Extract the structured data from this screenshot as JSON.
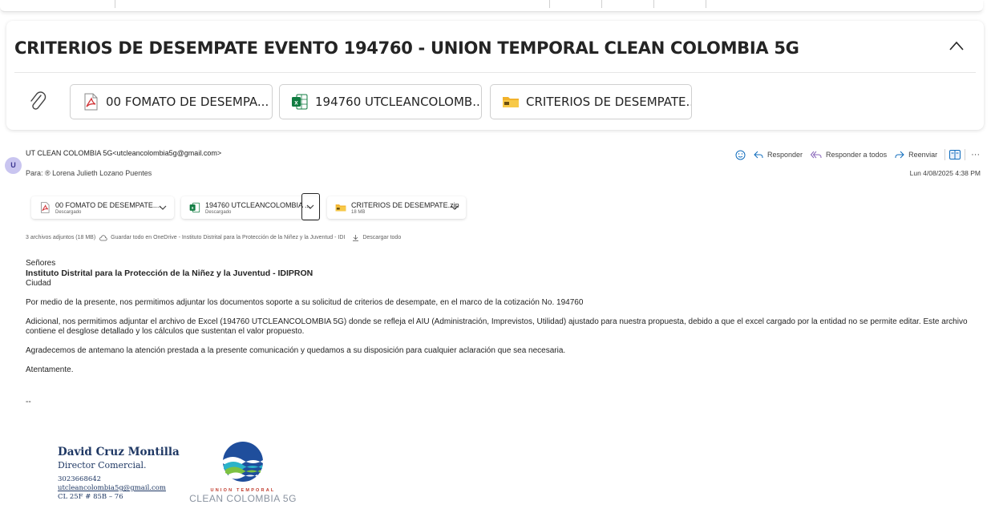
{
  "email": {
    "subject": "CRITERIOS DE DESEMPATE EVENTO 194760 - UNION TEMPORAL CLEAN COLOMBIA 5G",
    "top_attachments": [
      {
        "name": "00 FOMATO DE DESEMPA...",
        "icon": "pdf-icon"
      },
      {
        "name": "194760 UTCLEANCOLOMB...",
        "icon": "excel-icon"
      },
      {
        "name": "CRITERIOS DE DESEMPATE...",
        "icon": "zip-folder-icon"
      }
    ],
    "avatar_initial": "U",
    "sender": "UT CLEAN COLOMBIA 5G<utcleancolombia5g@gmail.com>",
    "to": "Para: ® Lorena Julieth Lozano Puentes",
    "date": "Lun 4/08/2025 4:38 PM",
    "actions": {
      "reply": "Responder",
      "reply_all": "Responder a todos",
      "forward": "Reenviar",
      "more": "···"
    },
    "attachments": [
      {
        "name": "00 FOMATO DE DESEMPATE....",
        "status": "Descargado"
      },
      {
        "name": "194760 UTCLEANCOLOMBIA ...",
        "status": "Descargado"
      },
      {
        "name": "CRITERIOS DE DESEMPATE.zip",
        "status": "18 MB"
      }
    ],
    "attachments_summary": {
      "count": "3 archivos adjuntos (18 MB)",
      "save_onedrive": "Guardar todo en OneDrive - Instituto Distrital para la Protección de la Niñez y la Juventud - IDI",
      "download_all": "Descargar todo"
    },
    "body": {
      "salutation": "Señores",
      "institution": "Instituto Distrital para la Protección de la Niñez y la Juventud - IDIPRON",
      "city": "Ciudad",
      "p1": "Por medio de la presente, nos permitimos adjuntar los documentos soporte a su solicitud de criterios de desempate, en el marco de la cotización No. 194760",
      "p2": "Adicional, nos permitimos adjuntar el archivo de Excel (194760 UTCLEANCOLOMBIA 5G) donde se refleja el AIU (Administración, Imprevistos, Utilidad) ajustado para nuestra propuesta, debido a que el excel cargado por la entidad no se permite editar. Este archivo contiene el desglose detallado y los cálculos que sustentan el valor propuesto.",
      "p3": "Agradecemos de antemano la atención prestada a la presente comunicación y quedamos a su disposición para cualquier aclaración que sea necesaria.",
      "closing": "Atentamente.",
      "separator": "--"
    },
    "signature": {
      "name": "David Cruz Montilla",
      "title": "Director Comercial.",
      "phone": "3023668642",
      "email": "utcleancolombia5g@gmail.com",
      "address": "CL 25F # 85B – 76",
      "logo_line1": "UNION TEMPORAL",
      "logo_line2": "CLEAN COLOMBIA 5G"
    }
  },
  "colors": {
    "accent": "#0f6cbd",
    "excel": "#107c41",
    "pdf": "#d13438",
    "zip": "#f2b22b",
    "sig": "#1f3864"
  }
}
